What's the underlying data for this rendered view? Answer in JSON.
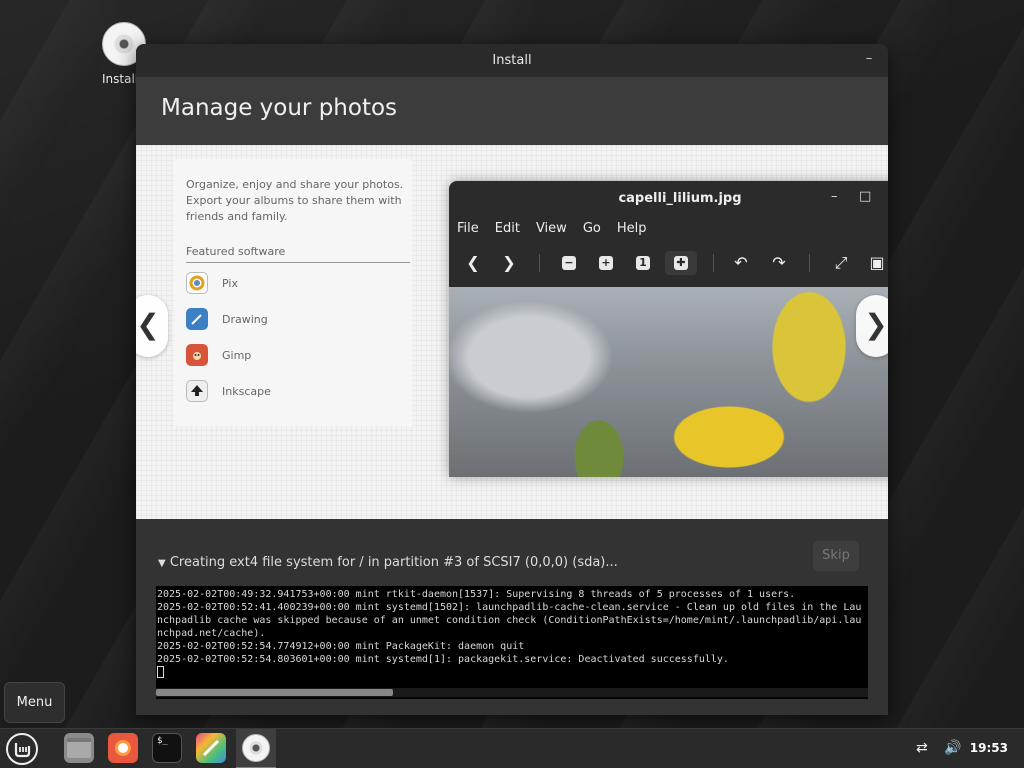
{
  "desktop": {
    "icon_label": "Install",
    "icon_name": "install-disc-icon"
  },
  "window": {
    "title": "Install",
    "header_title": "Manage your photos"
  },
  "slide": {
    "description": "Organize, enjoy and share your photos. Export your albums to share them with friends and family.",
    "featured_label": "Featured software",
    "apps": [
      {
        "name": "Pix",
        "icon": "pix-icon"
      },
      {
        "name": "Drawing",
        "icon": "drawing-icon"
      },
      {
        "name": "Gimp",
        "icon": "gimp-icon"
      },
      {
        "name": "Inkscape",
        "icon": "inkscape-icon"
      }
    ],
    "viewer": {
      "title": "capelli_lilium.jpg",
      "menu": [
        "File",
        "Edit",
        "View",
        "Go",
        "Help"
      ]
    }
  },
  "progress": {
    "status": "Creating ext4 file system for / in partition #3 of SCSI7 (0,0,0) (sda)...",
    "skip_label": "Skip",
    "log": "2025-02-02T00:49:32.941753+00:00 mint rtkit-daemon[1537]: Supervising 8 threads of 5 processes of 1 users.\n2025-02-02T00:52:41.400239+00:00 mint systemd[1502]: launchpadlib-cache-clean.service - Clean up old files in the Launchpadlib cache was skipped because of an unmet condition check (ConditionPathExists=/home/mint/.launchpadlib/api.launchpad.net/cache).\n2025-02-02T00:52:54.774912+00:00 mint PackageKit: daemon quit\n2025-02-02T00:52:54.803601+00:00 mint systemd[1]: packagekit.service: Deactivated successfully."
  },
  "taskbar": {
    "menu_tooltip": "Menu",
    "clock": "19:53"
  },
  "colors": {
    "accent": "#4a90d9",
    "window_bg": "#2f2f2f",
    "header_bg": "#3c3c3c"
  }
}
